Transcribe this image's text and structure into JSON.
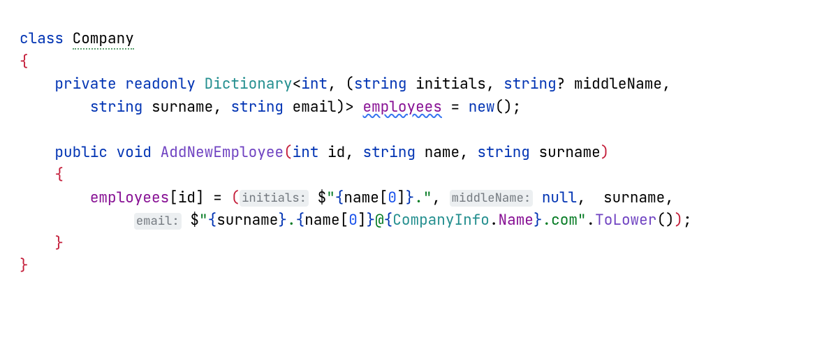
{
  "line1": {
    "kw_class": "class",
    "class_name": "Company"
  },
  "line3": {
    "kw_private": "private",
    "kw_readonly": "readonly",
    "type_dict": "Dictionary",
    "type_int": "int",
    "type_string1": "string",
    "tuple_initials": "initials",
    "type_string2": "string",
    "nullable": "?",
    "tuple_middle": "middleName",
    "comma": ","
  },
  "line4": {
    "type_string3": "string",
    "tuple_surname": "surname",
    "type_string4": "string",
    "tuple_email": "email",
    "field_employees": "employees",
    "eq": "=",
    "kw_new": "new",
    "parens": "()",
    "semi": ";"
  },
  "line6": {
    "kw_public": "public",
    "kw_void": "void",
    "method": "AddNewEmployee",
    "type_int": "int",
    "p_id": "id",
    "type_string1": "string",
    "p_name": "name",
    "type_string2": "string",
    "p_surname": "surname"
  },
  "line8": {
    "field": "employees",
    "lbrack": "[",
    "idx": "id",
    "rbrack": "]",
    "eq": " = ",
    "lpar": "(",
    "hint_initials": "initials:",
    "dollar": "$",
    "q1": "\"",
    "lb1": "{",
    "expr_name": "name",
    "lb2": "[",
    "zero": "0",
    "rb2": "]",
    "rb1": "}",
    "dotq": ".",
    "q2": "\"",
    "comma1": ", ",
    "hint_middle": "middleName:",
    "null": "null",
    "comma2": ",  ",
    "surname": "surname",
    "comma3": ","
  },
  "line9": {
    "hint_email": "email:",
    "dollar": "$",
    "q1": "\"",
    "lb1": "{",
    "surname": "surname",
    "rb1": "}",
    "dot1": ".",
    "lb2": "{",
    "name": "name",
    "lbk": "[",
    "zero": "0",
    "rbk": "]",
    "rb2": "}",
    "at": "@",
    "lb3": "{",
    "company": "CompanyInfo",
    "dot2": ".",
    "prop": "Name",
    "rb3": "}",
    "dotcom": ".com",
    "q2": "\"",
    "dot3": ".",
    "tolower": "ToLower",
    "parens": "()",
    "rparen": ")",
    "semi": ";"
  },
  "braces": {
    "open": "{",
    "close": "}"
  }
}
